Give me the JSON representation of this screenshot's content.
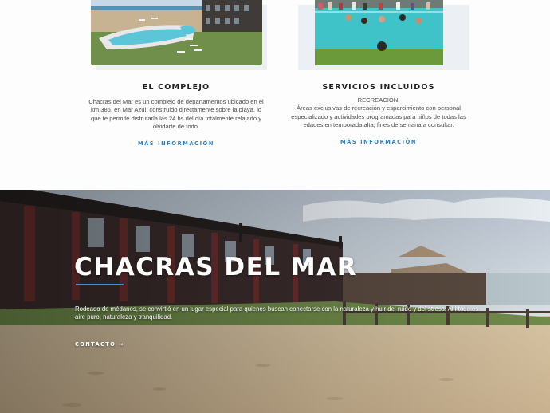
{
  "features": [
    {
      "image_desc": "pool-with-deck-chairs-and-building",
      "title": "EL COMPLEJO",
      "text": "Chacras del Mar es un complejo de departamentos ubicado en el km 386, en Mar Azul, construido directamente sobre la playa, lo que te permite disfrutarla las 24 hs del día totalmente relajado y olvidarte de todo.",
      "link": "MÁS INFORMACIÓN"
    },
    {
      "image_desc": "people-swimming-in-pool",
      "title": "SERVICIOS INCLUIDOS",
      "text_heading": "RECREACIÓN:",
      "text": "Áreas exclusivas de recreación y esparcimiento con personal especializado y actividades programadas para niños de todas las edades en temporada alta, fines de semana a consultar.",
      "link": "MÁS INFORMACIÓN"
    }
  ],
  "hero": {
    "title": "CHACRAS DEL MAR",
    "text": "Rodeado de médanos, se convirtió en un lugar especial para quienes buscan conectarse con la naturaleza y huir del ruido y del stress. Allí todo es aire puro, naturaleza y tranquilidad.",
    "cta": "CONTACTO →"
  },
  "colors": {
    "accent": "#2e7fc1",
    "rule": "#3a8fdd",
    "title": "#1e1e1e",
    "body": "#4a4a4a"
  }
}
